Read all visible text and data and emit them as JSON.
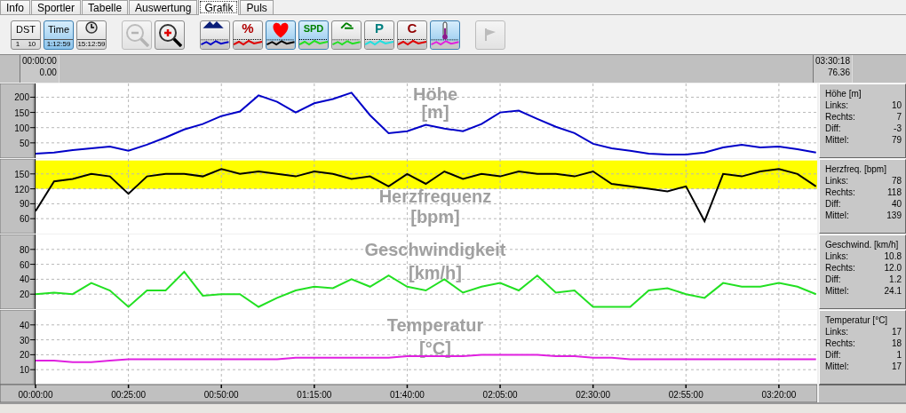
{
  "tabs": [
    {
      "label": "Info",
      "selected": false
    },
    {
      "label": "Sportler",
      "selected": false
    },
    {
      "label": "Tabelle",
      "selected": false
    },
    {
      "label": "Auswertung",
      "selected": false
    },
    {
      "label": "Grafik",
      "selected": true
    },
    {
      "label": "Puls",
      "selected": false
    }
  ],
  "toolbar": [
    {
      "kind": "dst",
      "label": "DST",
      "scale": [
        "1",
        "10"
      ],
      "selected": false
    },
    {
      "kind": "time",
      "label": "Time",
      "reading": "1:12:59",
      "selected": true
    },
    {
      "kind": "clock",
      "reading": "15:12:59",
      "selected": false
    },
    {
      "kind": "zoom_out",
      "disabled": true
    },
    {
      "kind": "zoom_in",
      "disabled": false
    },
    {
      "kind": "altitude",
      "selected": false
    },
    {
      "kind": "percent",
      "glyph": "%",
      "selected": false
    },
    {
      "kind": "heart",
      "selected": true
    },
    {
      "kind": "speed",
      "glyph": "SPD",
      "selected": true
    },
    {
      "kind": "cadence",
      "selected": false
    },
    {
      "kind": "power",
      "glyph": "P",
      "selected": false
    },
    {
      "kind": "calories",
      "glyph": "C",
      "selected": false
    },
    {
      "kind": "temperature",
      "selected": true
    },
    {
      "kind": "flag",
      "disabled": true
    }
  ],
  "range": {
    "start": {
      "time": "00:00:00",
      "value": "0.00"
    },
    "end": {
      "time": "03:30:18",
      "value": "76.36"
    }
  },
  "charts": [
    {
      "chart_data": {
        "type": "line",
        "title": "Höhe [m]",
        "x": [
          0,
          5,
          10,
          15,
          20,
          25,
          30,
          35,
          40,
          45,
          50,
          55,
          60,
          65,
          70,
          75,
          80,
          85,
          90,
          95,
          100,
          105,
          110,
          115,
          120,
          125,
          130,
          135,
          140,
          145,
          150,
          155,
          160,
          165,
          170,
          175,
          180,
          185,
          190,
          195,
          200,
          205,
          210
        ],
        "xlim": [
          0,
          210.3
        ],
        "ylim": [
          0,
          245
        ],
        "grid": true,
        "yticks": [
          {
            "value": 50,
            "label": "50"
          },
          {
            "value": 100,
            "label": "100"
          },
          {
            "value": 150,
            "label": "150"
          },
          {
            "value": 200,
            "label": "200"
          }
        ],
        "series": [
          {
            "color": "#0000c8",
            "values": [
              15,
              18,
              26,
              32,
              38,
              24,
              44,
              68,
              94,
              112,
              138,
              153,
              206,
              185,
              150,
              180,
              194,
              215,
              141,
              82,
              88,
              109,
              97,
              88,
              112,
              150,
              156,
              129,
              103,
              82,
              47,
              32,
              24,
              15,
              12,
              12,
              18,
              35,
              44,
              35,
              38,
              29,
              18
            ]
          }
        ]
      },
      "stats": {
        "title": "Höhe [m]",
        "rows": [
          {
            "label": "Links:",
            "value": "10"
          },
          {
            "label": "Rechts:",
            "value": "7"
          },
          {
            "label": "Diff:",
            "value": "-3"
          },
          {
            "label": "Mittel:",
            "value": "79"
          }
        ]
      }
    },
    {
      "chart_data": {
        "type": "line",
        "title": "Herzfrequenz [bpm]",
        "x": [
          0,
          5,
          10,
          15,
          20,
          25,
          30,
          35,
          40,
          45,
          50,
          55,
          60,
          65,
          70,
          75,
          80,
          85,
          90,
          95,
          100,
          105,
          110,
          115,
          120,
          125,
          130,
          135,
          140,
          145,
          150,
          155,
          160,
          165,
          170,
          175,
          180,
          185,
          190,
          195,
          200,
          205,
          210
        ],
        "xlim": [
          0,
          210.3
        ],
        "ylim": [
          30,
          180
        ],
        "yticks": [
          {
            "value": 60,
            "label": "60"
          },
          {
            "value": 90,
            "label": "90"
          },
          {
            "value": 120,
            "label": "120"
          },
          {
            "value": 150,
            "label": "150"
          }
        ],
        "bands": [
          {
            "axis": "y",
            "from": 120,
            "to": 177,
            "color": "#ffff00"
          }
        ],
        "grid": true,
        "series": [
          {
            "color": "#000000",
            "values": [
              75,
              135,
              140,
              150,
              145,
              110,
              145,
              150,
              150,
              145,
              160,
              150,
              155,
              150,
              145,
              155,
              150,
              140,
              145,
              125,
              150,
              130,
              155,
              140,
              150,
              145,
              155,
              150,
              150,
              145,
              155,
              130,
              125,
              120,
              115,
              125,
              55,
              150,
              145,
              155,
              160,
              150,
              125
            ]
          }
        ]
      },
      "stats": {
        "title": "Herzfreq. [bpm]",
        "rows": [
          {
            "label": "Links:",
            "value": "78"
          },
          {
            "label": "Rechts:",
            "value": "118"
          },
          {
            "label": "Diff:",
            "value": "40"
          },
          {
            "label": "Mittel:",
            "value": "139"
          }
        ]
      }
    },
    {
      "chart_data": {
        "type": "line",
        "title": "Geschwindigkeit [km/h]",
        "x": [
          0,
          5,
          10,
          15,
          20,
          25,
          30,
          35,
          40,
          45,
          50,
          55,
          60,
          65,
          70,
          75,
          80,
          85,
          90,
          95,
          100,
          105,
          110,
          115,
          120,
          125,
          130,
          135,
          140,
          145,
          150,
          155,
          160,
          165,
          170,
          175,
          180,
          185,
          190,
          195,
          200,
          205,
          210
        ],
        "xlim": [
          0,
          210.3
        ],
        "ylim": [
          0,
          100
        ],
        "grid": true,
        "yticks": [
          {
            "value": 20,
            "label": "20"
          },
          {
            "value": 40,
            "label": "40"
          },
          {
            "value": 60,
            "label": "60"
          },
          {
            "value": 80,
            "label": "80"
          }
        ],
        "series": [
          {
            "color": "#22e022",
            "values": [
              20,
              22,
              20,
              35,
              25,
              3,
              25,
              25,
              50,
              18,
              20,
              20,
              3,
              15,
              25,
              30,
              28,
              40,
              30,
              45,
              30,
              25,
              40,
              22,
              30,
              35,
              25,
              45,
              22,
              25,
              3,
              3,
              3,
              25,
              28,
              20,
              15,
              35,
              30,
              30,
              35,
              30,
              20
            ]
          }
        ]
      },
      "stats": {
        "title": "Geschwind. [km/h]",
        "rows": [
          {
            "label": "Links:",
            "value": "10.8"
          },
          {
            "label": "Rechts:",
            "value": "12.0"
          },
          {
            "label": "Diff:",
            "value": "1.2"
          },
          {
            "label": "Mittel:",
            "value": "24.1"
          }
        ]
      }
    },
    {
      "chart_data": {
        "type": "line",
        "title": "Temperatur [°C]",
        "x": [
          0,
          5,
          10,
          15,
          20,
          25,
          30,
          35,
          40,
          45,
          50,
          55,
          60,
          65,
          70,
          75,
          80,
          85,
          90,
          95,
          100,
          105,
          110,
          115,
          120,
          125,
          130,
          135,
          140,
          145,
          150,
          155,
          160,
          165,
          170,
          175,
          180,
          185,
          190,
          195,
          200,
          205,
          210
        ],
        "xlim": [
          0,
          210.3
        ],
        "ylim": [
          0,
          50
        ],
        "grid": true,
        "yticks": [
          {
            "value": 10,
            "label": "10"
          },
          {
            "value": 20,
            "label": "20"
          },
          {
            "value": 30,
            "label": "30"
          },
          {
            "value": 40,
            "label": "40"
          }
        ],
        "xticks": [
          {
            "value": 0,
            "label": "00:00:00"
          },
          {
            "value": 25,
            "label": "00:25:00"
          },
          {
            "value": 50,
            "label": "00:50:00"
          },
          {
            "value": 75,
            "label": "01:15:00"
          },
          {
            "value": 100,
            "label": "01:40:00"
          },
          {
            "value": 125,
            "label": "02:05:00"
          },
          {
            "value": 150,
            "label": "02:30:00"
          },
          {
            "value": 175,
            "label": "02:55:00"
          },
          {
            "value": 200,
            "label": "03:20:00"
          }
        ],
        "series": [
          {
            "color": "#e020e0",
            "values": [
              16,
              16,
              15,
              15,
              16,
              17,
              17,
              17,
              17,
              17,
              17,
              17,
              17,
              17,
              18,
              18,
              18,
              18,
              18,
              18,
              19,
              19,
              19,
              19,
              20,
              20,
              20,
              20,
              19,
              19,
              18,
              18,
              17,
              17,
              17,
              17,
              17,
              17,
              17,
              17,
              17,
              17,
              17
            ]
          }
        ]
      },
      "stats": {
        "title": "Temperatur [°C]",
        "rows": [
          {
            "label": "Links:",
            "value": "17"
          },
          {
            "label": "Rechts:",
            "value": "18"
          },
          {
            "label": "Diff:",
            "value": "1"
          },
          {
            "label": "Mittel:",
            "value": "17"
          }
        ]
      }
    }
  ]
}
